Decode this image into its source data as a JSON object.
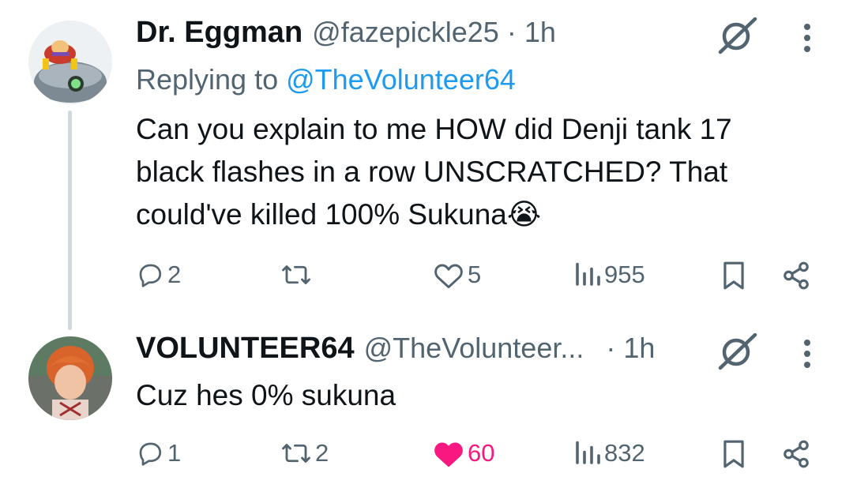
{
  "tweets": [
    {
      "display_name": "Dr. Eggman",
      "handle": "@fazepickle25",
      "time": "· 1h",
      "reply_prefix": "Replying to",
      "reply_to": "@TheVolunteer64",
      "text": "Can you explain to me HOW did Denji tank 17 black flashes in a row UNSCRATCHED? That could've killed 100% Sukuna",
      "emoji": "😭",
      "actions": {
        "replies": "2",
        "reposts": "",
        "likes": "5",
        "views": "955"
      },
      "liked": false
    },
    {
      "display_name": "VOLUNTEER64",
      "handle": "@TheVolunteer...",
      "time": "· 1h",
      "text": "Cuz hes 0% sukuna",
      "actions": {
        "replies": "1",
        "reposts": "2",
        "likes": "60",
        "views": "832"
      },
      "liked": true
    }
  ],
  "colors": {
    "text": "#0f1419",
    "secondary": "#536471",
    "link": "#1d9bf0",
    "like": "#f91880",
    "thread": "#cfd9de"
  },
  "icons": [
    "reply-icon",
    "repost-icon",
    "like-icon",
    "views-icon",
    "bookmark-icon",
    "share-icon",
    "grok-icon",
    "more-icon"
  ]
}
